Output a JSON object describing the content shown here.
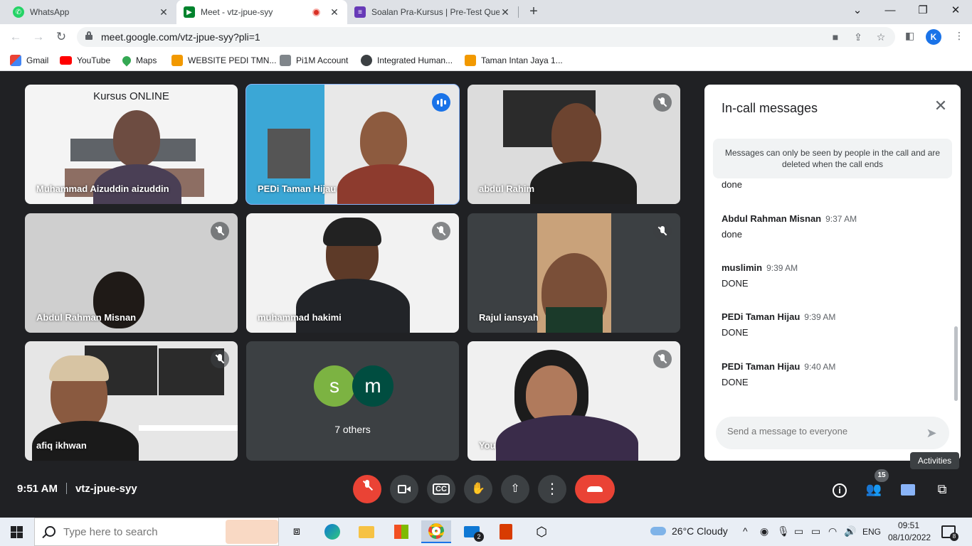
{
  "browser": {
    "tabs": [
      {
        "label": "WhatsApp",
        "icon": "whatsapp-icon",
        "color": "#25d366"
      },
      {
        "label": "Meet - vtz-jpue-syy",
        "icon": "google-meet-icon",
        "color": "#00832d"
      },
      {
        "label": "Soalan Pra-Kursus | Pre-Test Que",
        "icon": "google-forms-icon",
        "color": "#673ab7"
      }
    ],
    "url": "meet.google.com/vtz-jpue-syy?pli=1",
    "profile_initial": "K",
    "bookmarks": [
      {
        "label": "Gmail",
        "icon": "gmail-icon"
      },
      {
        "label": "YouTube",
        "icon": "youtube-icon"
      },
      {
        "label": "Maps",
        "icon": "maps-icon"
      },
      {
        "label": "WEBSITE PEDI TMN...",
        "icon": "pedi-icon"
      },
      {
        "label": "Pi1M Account",
        "icon": "pi1m-icon"
      },
      {
        "label": "Integrated Human...",
        "icon": "globe-icon"
      },
      {
        "label": "Taman Intan Jaya 1...",
        "icon": "pedi-icon"
      }
    ]
  },
  "meet": {
    "participants": [
      {
        "name": "Muhammad Aizuddin aizuddin",
        "slide_title": "Kursus ONLINE",
        "muted": false,
        "speaking": false
      },
      {
        "name": "PEDi Taman Hijau",
        "muted": false,
        "speaking": true
      },
      {
        "name": "abdul Rahim",
        "muted": true
      },
      {
        "name": "Abdul Rahman Misnan",
        "muted": true
      },
      {
        "name": "muhammad hakimi",
        "muted": true
      },
      {
        "name": "Rajul iansyah",
        "muted": true
      },
      {
        "name": "afiq ikhwan",
        "muted": true
      },
      {
        "name": "7 others",
        "avatars": [
          "s",
          "m"
        ],
        "avatar_colors": [
          "#7cb342",
          "#004d40"
        ]
      },
      {
        "name": "You",
        "muted": true
      }
    ],
    "chat": {
      "title": "In-call messages",
      "notice": "Messages can only be seen by people in the call and are deleted when the call ends",
      "partial_text": "done",
      "messages": [
        {
          "sender": "Abdul Rahman Misnan",
          "time": "9:37 AM",
          "text": "done"
        },
        {
          "sender": "muslimin",
          "time": "9:39 AM",
          "text": "DONE"
        },
        {
          "sender": "PEDi Taman Hijau",
          "time": "9:39 AM",
          "text": "DONE"
        },
        {
          "sender": "PEDi Taman Hijau",
          "time": "9:40 AM",
          "text": "DONE"
        }
      ],
      "input_placeholder": "Send a message to everyone"
    },
    "time": "9:51 AM",
    "meeting_code": "vtz-jpue-syy",
    "people_count": "15",
    "tooltip": "Activities"
  },
  "taskbar": {
    "search_placeholder": "Type here to search",
    "mail_badge": "2",
    "weather": "26°C  Cloudy",
    "language": "ENG",
    "clock_time": "09:51",
    "clock_date": "08/10/2022",
    "notification_count": "8"
  },
  "colors": {
    "meet_bg": "#202124",
    "end_call": "#ea4335",
    "accent": "#1a73e8"
  }
}
